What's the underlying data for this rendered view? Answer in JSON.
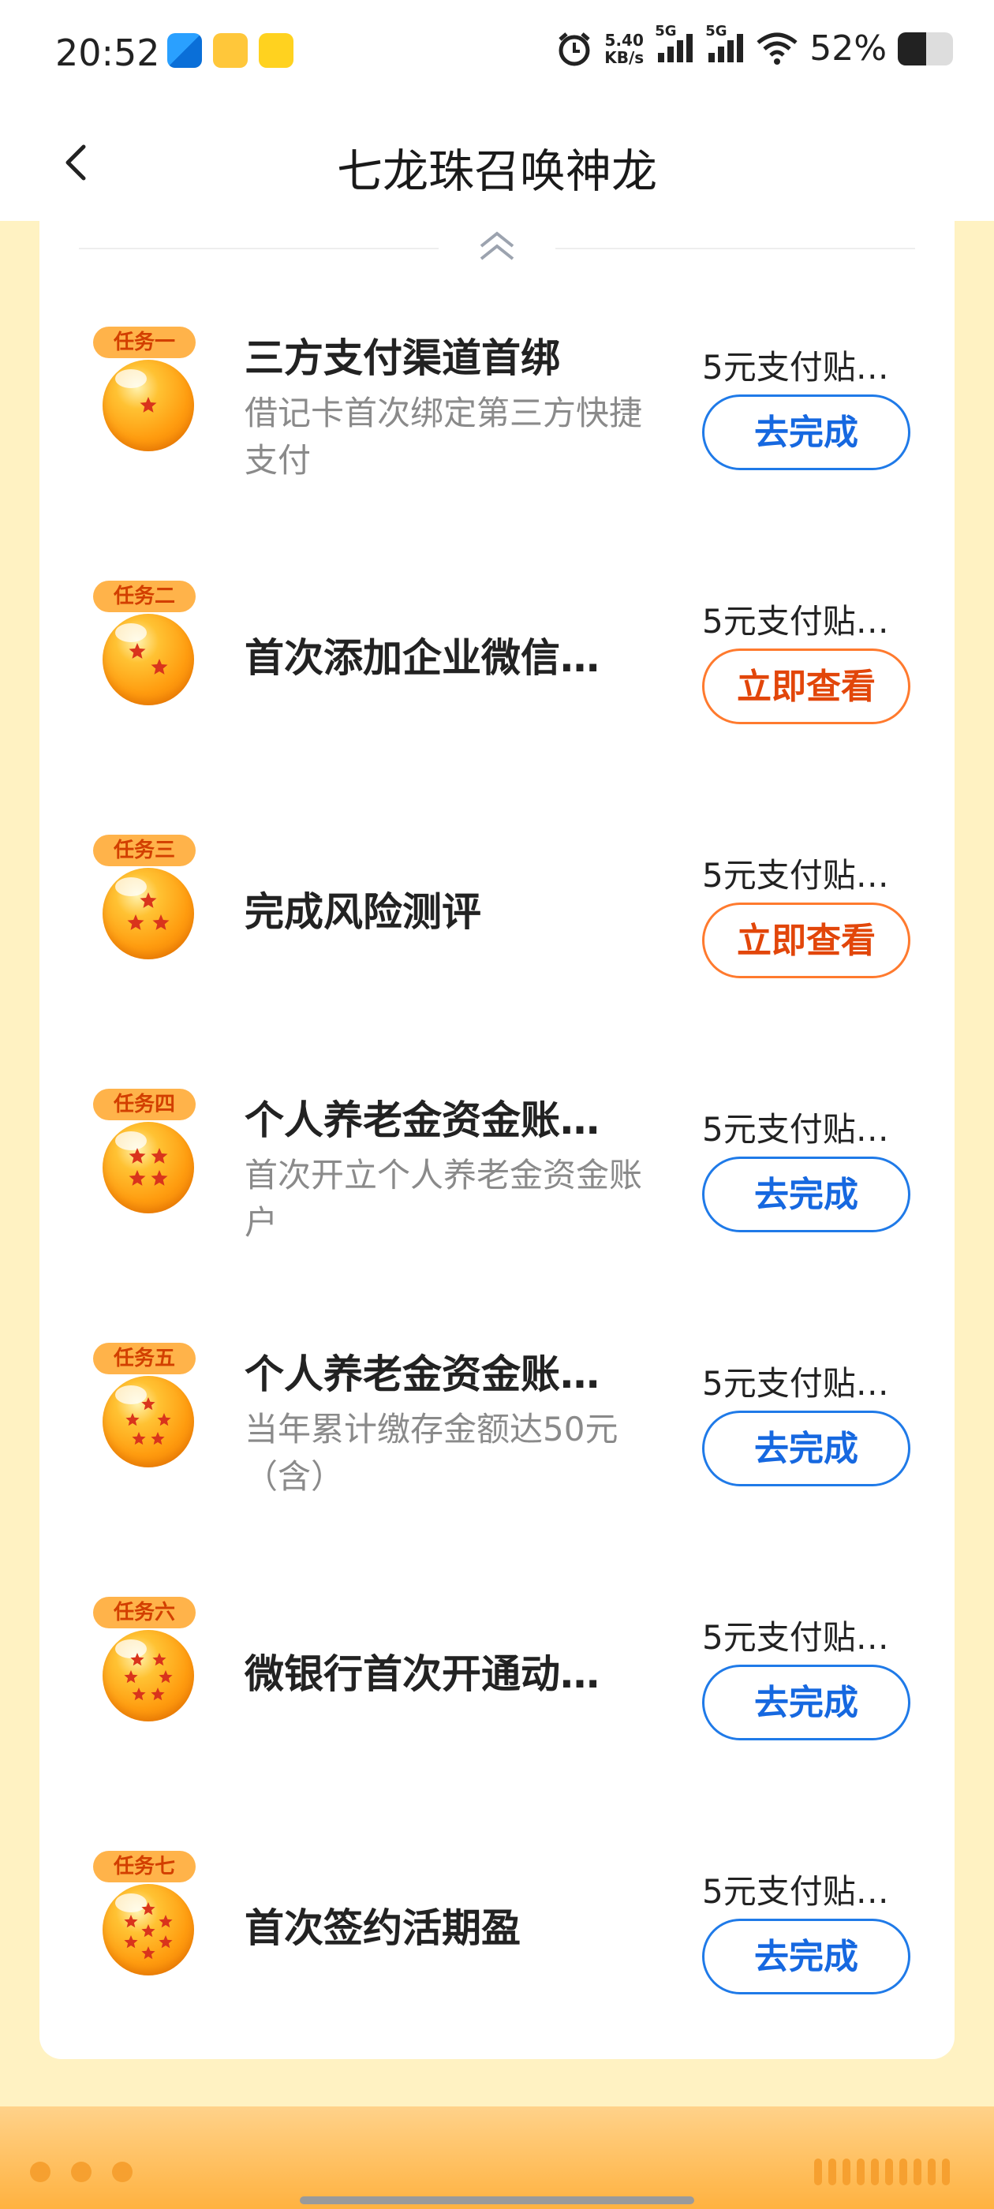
{
  "status_bar": {
    "time": "20:52",
    "net_speed_value": "5.40",
    "net_speed_unit": "KB/s",
    "signal_1": "5G",
    "signal_2": "5G",
    "battery_text": "52%",
    "battery_level": 0.52
  },
  "header": {
    "title": "七龙珠召唤神龙"
  },
  "tasks": [
    {
      "badge": "任务一",
      "stars": 1,
      "title": "三方支付渠道首绑",
      "desc": "借记卡首次绑定第三方快捷支付",
      "reward": "5元支付贴…",
      "button": "去完成",
      "button_style": "blue"
    },
    {
      "badge": "任务二",
      "stars": 2,
      "title": "首次添加企业微信…",
      "desc": "",
      "reward": "5元支付贴…",
      "button": "立即查看",
      "button_style": "orange"
    },
    {
      "badge": "任务三",
      "stars": 3,
      "title": "完成风险测评",
      "desc": "",
      "reward": "5元支付贴…",
      "button": "立即查看",
      "button_style": "orange"
    },
    {
      "badge": "任务四",
      "stars": 4,
      "title": "个人养老金资金账…",
      "desc": "首次开立个人养老金资金账户",
      "reward": "5元支付贴…",
      "button": "去完成",
      "button_style": "blue"
    },
    {
      "badge": "任务五",
      "stars": 5,
      "title": "个人养老金资金账…",
      "desc": "当年累计缴存金额达50元（含）",
      "reward": "5元支付贴…",
      "button": "去完成",
      "button_style": "blue"
    },
    {
      "badge": "任务六",
      "stars": 6,
      "title": "微银行首次开通动…",
      "desc": "",
      "reward": "5元支付贴…",
      "button": "去完成",
      "button_style": "blue"
    },
    {
      "badge": "任务七",
      "stars": 7,
      "title": "首次签约活期盈",
      "desc": "",
      "reward": "5元支付贴…",
      "button": "去完成",
      "button_style": "blue"
    }
  ],
  "colors": {
    "blue_button": "#1f7ae8",
    "orange_button": "#ff7a2e",
    "badge_bg": "#ffb34a",
    "page_bg": "#fff2c2"
  }
}
